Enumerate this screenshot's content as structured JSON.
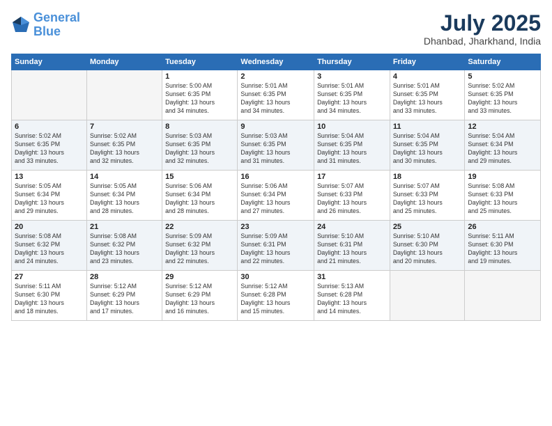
{
  "header": {
    "logo_line1": "General",
    "logo_line2": "Blue",
    "month_year": "July 2025",
    "location": "Dhanbad, Jharkhand, India"
  },
  "weekdays": [
    "Sunday",
    "Monday",
    "Tuesday",
    "Wednesday",
    "Thursday",
    "Friday",
    "Saturday"
  ],
  "weeks": [
    [
      {
        "day": "",
        "info": ""
      },
      {
        "day": "",
        "info": ""
      },
      {
        "day": "1",
        "info": "Sunrise: 5:00 AM\nSunset: 6:35 PM\nDaylight: 13 hours\nand 34 minutes."
      },
      {
        "day": "2",
        "info": "Sunrise: 5:01 AM\nSunset: 6:35 PM\nDaylight: 13 hours\nand 34 minutes."
      },
      {
        "day": "3",
        "info": "Sunrise: 5:01 AM\nSunset: 6:35 PM\nDaylight: 13 hours\nand 34 minutes."
      },
      {
        "day": "4",
        "info": "Sunrise: 5:01 AM\nSunset: 6:35 PM\nDaylight: 13 hours\nand 33 minutes."
      },
      {
        "day": "5",
        "info": "Sunrise: 5:02 AM\nSunset: 6:35 PM\nDaylight: 13 hours\nand 33 minutes."
      }
    ],
    [
      {
        "day": "6",
        "info": "Sunrise: 5:02 AM\nSunset: 6:35 PM\nDaylight: 13 hours\nand 33 minutes."
      },
      {
        "day": "7",
        "info": "Sunrise: 5:02 AM\nSunset: 6:35 PM\nDaylight: 13 hours\nand 32 minutes."
      },
      {
        "day": "8",
        "info": "Sunrise: 5:03 AM\nSunset: 6:35 PM\nDaylight: 13 hours\nand 32 minutes."
      },
      {
        "day": "9",
        "info": "Sunrise: 5:03 AM\nSunset: 6:35 PM\nDaylight: 13 hours\nand 31 minutes."
      },
      {
        "day": "10",
        "info": "Sunrise: 5:04 AM\nSunset: 6:35 PM\nDaylight: 13 hours\nand 31 minutes."
      },
      {
        "day": "11",
        "info": "Sunrise: 5:04 AM\nSunset: 6:35 PM\nDaylight: 13 hours\nand 30 minutes."
      },
      {
        "day": "12",
        "info": "Sunrise: 5:04 AM\nSunset: 6:34 PM\nDaylight: 13 hours\nand 29 minutes."
      }
    ],
    [
      {
        "day": "13",
        "info": "Sunrise: 5:05 AM\nSunset: 6:34 PM\nDaylight: 13 hours\nand 29 minutes."
      },
      {
        "day": "14",
        "info": "Sunrise: 5:05 AM\nSunset: 6:34 PM\nDaylight: 13 hours\nand 28 minutes."
      },
      {
        "day": "15",
        "info": "Sunrise: 5:06 AM\nSunset: 6:34 PM\nDaylight: 13 hours\nand 28 minutes."
      },
      {
        "day": "16",
        "info": "Sunrise: 5:06 AM\nSunset: 6:34 PM\nDaylight: 13 hours\nand 27 minutes."
      },
      {
        "day": "17",
        "info": "Sunrise: 5:07 AM\nSunset: 6:33 PM\nDaylight: 13 hours\nand 26 minutes."
      },
      {
        "day": "18",
        "info": "Sunrise: 5:07 AM\nSunset: 6:33 PM\nDaylight: 13 hours\nand 25 minutes."
      },
      {
        "day": "19",
        "info": "Sunrise: 5:08 AM\nSunset: 6:33 PM\nDaylight: 13 hours\nand 25 minutes."
      }
    ],
    [
      {
        "day": "20",
        "info": "Sunrise: 5:08 AM\nSunset: 6:32 PM\nDaylight: 13 hours\nand 24 minutes."
      },
      {
        "day": "21",
        "info": "Sunrise: 5:08 AM\nSunset: 6:32 PM\nDaylight: 13 hours\nand 23 minutes."
      },
      {
        "day": "22",
        "info": "Sunrise: 5:09 AM\nSunset: 6:32 PM\nDaylight: 13 hours\nand 22 minutes."
      },
      {
        "day": "23",
        "info": "Sunrise: 5:09 AM\nSunset: 6:31 PM\nDaylight: 13 hours\nand 22 minutes."
      },
      {
        "day": "24",
        "info": "Sunrise: 5:10 AM\nSunset: 6:31 PM\nDaylight: 13 hours\nand 21 minutes."
      },
      {
        "day": "25",
        "info": "Sunrise: 5:10 AM\nSunset: 6:30 PM\nDaylight: 13 hours\nand 20 minutes."
      },
      {
        "day": "26",
        "info": "Sunrise: 5:11 AM\nSunset: 6:30 PM\nDaylight: 13 hours\nand 19 minutes."
      }
    ],
    [
      {
        "day": "27",
        "info": "Sunrise: 5:11 AM\nSunset: 6:30 PM\nDaylight: 13 hours\nand 18 minutes."
      },
      {
        "day": "28",
        "info": "Sunrise: 5:12 AM\nSunset: 6:29 PM\nDaylight: 13 hours\nand 17 minutes."
      },
      {
        "day": "29",
        "info": "Sunrise: 5:12 AM\nSunset: 6:29 PM\nDaylight: 13 hours\nand 16 minutes."
      },
      {
        "day": "30",
        "info": "Sunrise: 5:12 AM\nSunset: 6:28 PM\nDaylight: 13 hours\nand 15 minutes."
      },
      {
        "day": "31",
        "info": "Sunrise: 5:13 AM\nSunset: 6:28 PM\nDaylight: 13 hours\nand 14 minutes."
      },
      {
        "day": "",
        "info": ""
      },
      {
        "day": "",
        "info": ""
      }
    ]
  ]
}
